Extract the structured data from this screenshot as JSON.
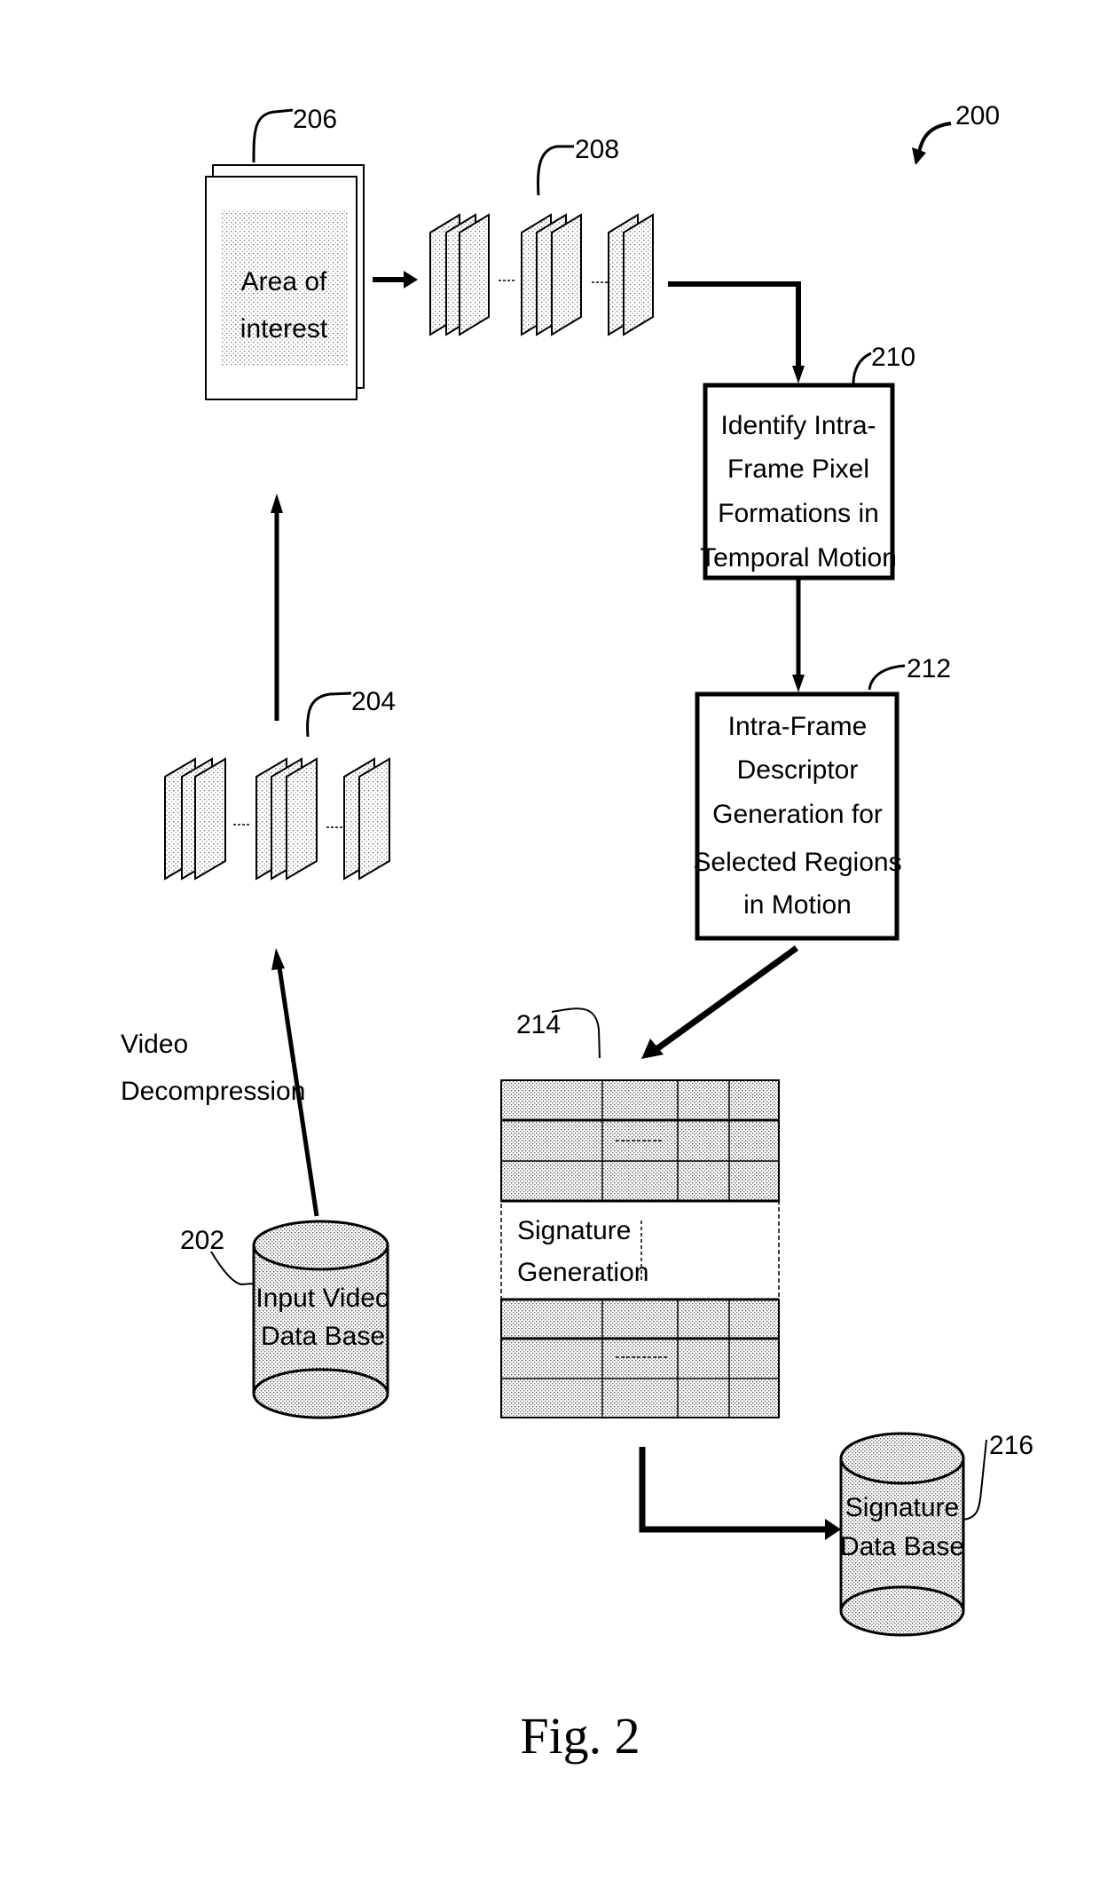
{
  "figure": {
    "caption": "Fig. 2",
    "reference": "200"
  },
  "nodes": {
    "input_db": {
      "ref": "202",
      "lines": [
        "Input Video",
        "Data Base"
      ]
    },
    "decoded_frames": {
      "ref": "204"
    },
    "area_of_interest": {
      "ref": "206",
      "lines": [
        "Area of",
        "interest"
      ]
    },
    "selected_frames": {
      "ref": "208"
    },
    "identify_box": {
      "ref": "210",
      "lines": [
        "Identify Intra-",
        "Frame Pixel",
        "Formations in",
        "Temporal Motion"
      ]
    },
    "descriptor_box": {
      "ref": "212",
      "lines": [
        "Intra-Frame",
        "Descriptor",
        "Generation for",
        "Selected Regions",
        "in Motion"
      ]
    },
    "signature_table": {
      "ref": "214",
      "lines": [
        "Signature",
        "Generation"
      ]
    },
    "signature_db": {
      "ref": "216",
      "lines": [
        "Signature",
        "Data Base"
      ]
    }
  },
  "edges": {
    "decompression_label": [
      "Video",
      "Decompression"
    ]
  },
  "colors": {
    "ink": "#000000",
    "paper": "#ffffff",
    "stipple": "#9a9a9a"
  }
}
